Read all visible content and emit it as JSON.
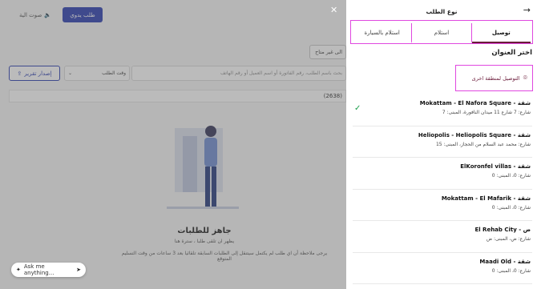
{
  "background": {
    "manual_order": "طلب يدوي",
    "voice_order": "صوت الية",
    "filter": "الى غير متاح",
    "export": "إصدار تقرير",
    "time_filter": "وقت الطلب",
    "search_placeholder": "بحث باسم الطلب، رقم الفاتورة أو اسم العميل أو رقم الهاتف",
    "count": "(2638)",
    "ready_title": "جاهز للطلبات",
    "ready_sub": "يظهر ان تلقى طلبا ، سترة هنا",
    "ready_note": "يرجى ملاحظة أن اي طلب لم يكتمل سيتنقل إلى الطلبات السابقة تلقائيا بعد 3 ساعات من وقت التسليم المتوقع",
    "ask_placeholder": "Ask me anything..."
  },
  "drawer": {
    "title": "نوع الطلب",
    "tabs": [
      {
        "label": "توصيل",
        "active": true
      },
      {
        "label": "استلام",
        "active": false
      },
      {
        "label": "استلام بالسيارة",
        "active": false
      }
    ],
    "address_heading": "اختر العنوان",
    "other_zone_label": "التوصيل لمنطقة اخرى",
    "addresses": [
      {
        "name": "شقة - Mokattam - El Nafora Square",
        "detail": "شارع: 7 شارع 11 ميدان النافورة، المبنى: 7",
        "selected": true
      },
      {
        "name": "شقة - Heliopolis - Heliopolis Square",
        "detail": "شارع: محمد عبد السلام من الحجاز، المبنى: 15",
        "selected": false
      },
      {
        "name": "شقة - ElKoronfel villas",
        "detail": "شارع: 0، المبنى: 0",
        "selected": false
      },
      {
        "name": "شقة - Mokattam - El Mafarik",
        "detail": "شارع: 0، المبنى: 0",
        "selected": false
      },
      {
        "name": "ض - El Rehab City",
        "detail": "شارع: ض، المبنى: ض",
        "selected": false
      },
      {
        "name": "شقة - Maadi Old",
        "detail": "شارع: 0، المبنى: 0",
        "selected": false
      }
    ]
  },
  "colors": {
    "accent": "#6b1b3a",
    "highlight_border": "#e048e0",
    "primary_button": "#4152b8",
    "check": "#1a9e4a"
  }
}
